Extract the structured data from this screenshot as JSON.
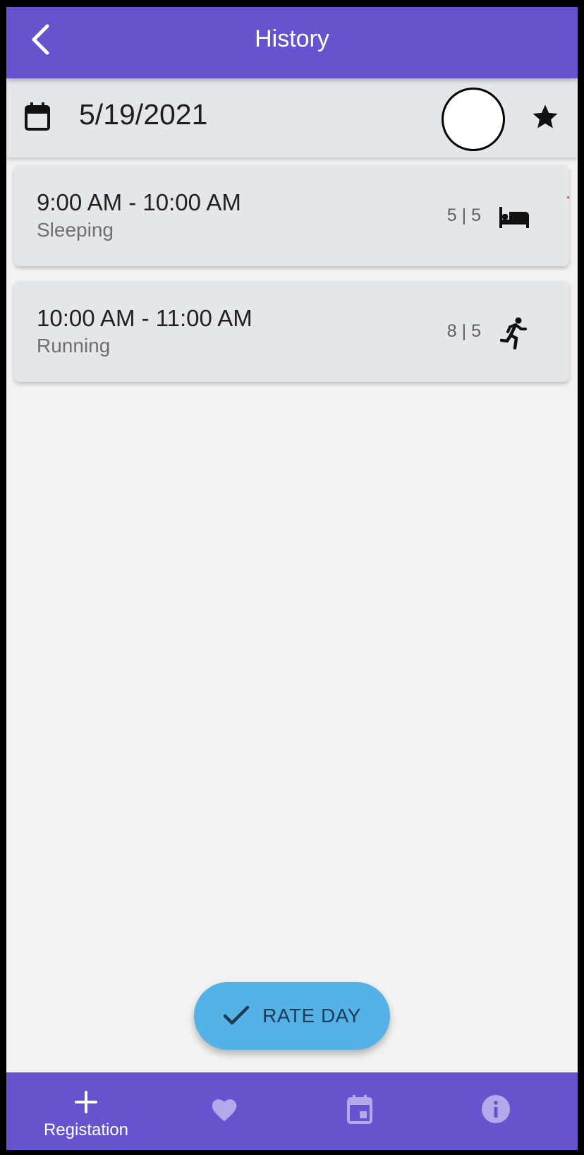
{
  "app_bar": {
    "title": "History",
    "back_icon": "chevron-left-icon"
  },
  "date_bar": {
    "date": "5/19/2021",
    "calendar_icon": "calendar-icon",
    "favorite_icon": "star-icon"
  },
  "entries": [
    {
      "time_range": "9:00 AM - 10:00 AM",
      "activity": "Sleeping",
      "score": "5 | 5",
      "icon": "bed-icon"
    },
    {
      "time_range": "10:00 AM - 11:00 AM",
      "activity": "Running",
      "score": "8 | 5",
      "icon": "running-icon"
    }
  ],
  "fab": {
    "label": "RATE DAY",
    "icon": "check-icon",
    "color": "#55b2e6"
  },
  "bottom_nav": {
    "items": [
      {
        "label": "Registation",
        "icon": "plus-icon",
        "active": true
      },
      {
        "icon": "heart-icon",
        "active": false
      },
      {
        "icon": "calendar-event-icon",
        "active": false
      },
      {
        "icon": "info-icon",
        "active": false
      }
    ]
  },
  "colors": {
    "primary": "#6654cf",
    "surface": "#e3e7ea",
    "background": "#f2f2f2",
    "inactive_nav_icon": "#b3a8ea"
  }
}
